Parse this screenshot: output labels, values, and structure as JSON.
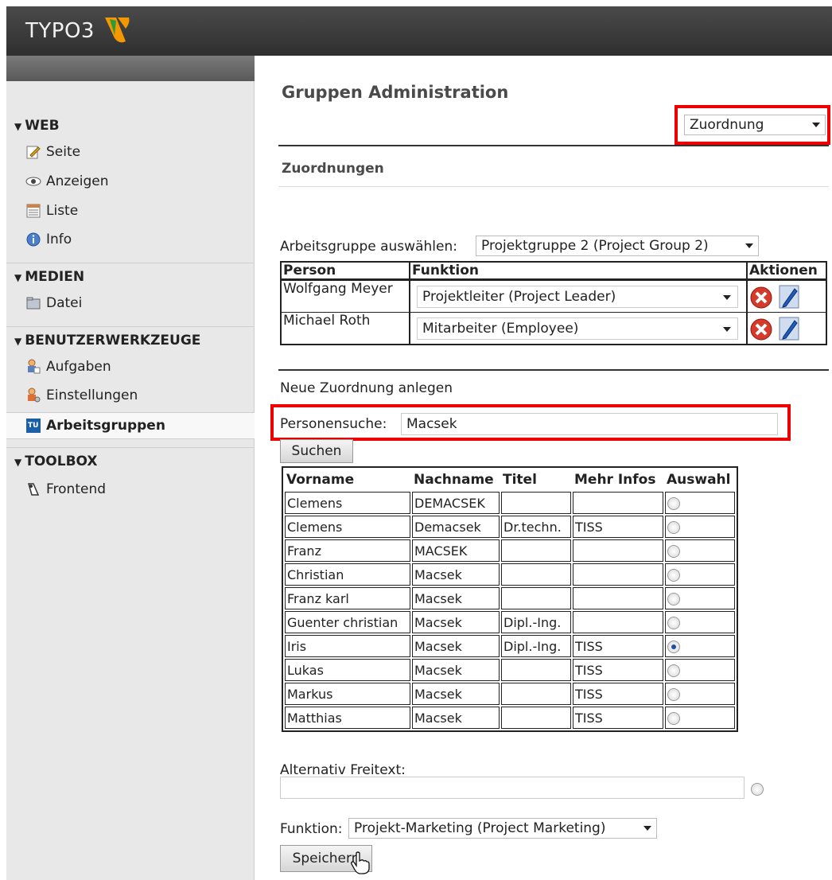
{
  "app": {
    "logo_text": "TYPO3"
  },
  "sidebar": {
    "sections": [
      {
        "label": "WEB",
        "items": [
          {
            "label": "Seite",
            "icon": "page-edit-icon"
          },
          {
            "label": "Anzeigen",
            "icon": "eye-icon"
          },
          {
            "label": "Liste",
            "icon": "list-icon"
          },
          {
            "label": "Info",
            "icon": "info-icon"
          }
        ]
      },
      {
        "label": "MEDIEN",
        "items": [
          {
            "label": "Datei",
            "icon": "folder-icon"
          }
        ]
      },
      {
        "label": "BENUTZERWERKZEUGE",
        "items": [
          {
            "label": "Aufgaben",
            "icon": "tasks-icon"
          },
          {
            "label": "Einstellungen",
            "icon": "user-settings-icon"
          },
          {
            "label": "Arbeitsgruppen",
            "icon": "tu-wien-icon",
            "active": true
          }
        ]
      },
      {
        "label": "TOOLBOX",
        "items": [
          {
            "label": "Frontend",
            "icon": "frontend-icon"
          }
        ]
      }
    ]
  },
  "main": {
    "title": "Gruppen Administration",
    "mode_select": "Zuordnung",
    "section_title": "Zuordnungen",
    "group_label": "Arbeitsgruppe auswählen:",
    "group_select": "Projektgruppe 2 (Project Group 2)",
    "assign_headers": [
      "Person",
      "Funktion",
      "Aktionen"
    ],
    "assignments": [
      {
        "person": "Wolfgang Meyer",
        "function": "Projektleiter (Project Leader)"
      },
      {
        "person": "Michael Roth",
        "function": "Mitarbeiter (Employee)"
      }
    ],
    "new_assign_title": "Neue Zuordnung anlegen",
    "search_label": "Personensuche:",
    "search_value": "Macsek",
    "search_button": "Suchen",
    "result_headers": [
      "Vorname",
      "Nachname",
      "Titel",
      "Mehr Infos",
      "Auswahl"
    ],
    "results": [
      {
        "first": "Clemens",
        "last": "DEMACSEK",
        "title": "",
        "info": "",
        "selected": false
      },
      {
        "first": "Clemens",
        "last": "Demacsek",
        "title": "Dr.techn.",
        "info": "TISS",
        "selected": false
      },
      {
        "first": "Franz",
        "last": "MACSEK",
        "title": "",
        "info": "",
        "selected": false
      },
      {
        "first": "Christian",
        "last": "Macsek",
        "title": "",
        "info": "",
        "selected": false
      },
      {
        "first": "Franz karl",
        "last": "Macsek",
        "title": "",
        "info": "",
        "selected": false
      },
      {
        "first": "Guenter christian",
        "last": "Macsek",
        "title": "Dipl.-Ing.",
        "info": "",
        "selected": false
      },
      {
        "first": "Iris",
        "last": "Macsek",
        "title": "Dipl.-Ing.",
        "info": "TISS",
        "selected": true
      },
      {
        "first": "Lukas",
        "last": "Macsek",
        "title": "",
        "info": "TISS",
        "selected": false
      },
      {
        "first": "Markus",
        "last": "Macsek",
        "title": "",
        "info": "TISS",
        "selected": false
      },
      {
        "first": "Matthias",
        "last": "Macsek",
        "title": "",
        "info": "TISS",
        "selected": false
      }
    ],
    "freetext_label": "Alternativ Freitext:",
    "freetext_value": "",
    "function_label": "Funktion:",
    "function_select": "Projekt-Marketing (Project Marketing)",
    "save_button": "Speichern"
  },
  "colors": {
    "highlight": "#e00000",
    "topbar": "#3a3a3a",
    "sidebar": "#e8e8e8"
  }
}
